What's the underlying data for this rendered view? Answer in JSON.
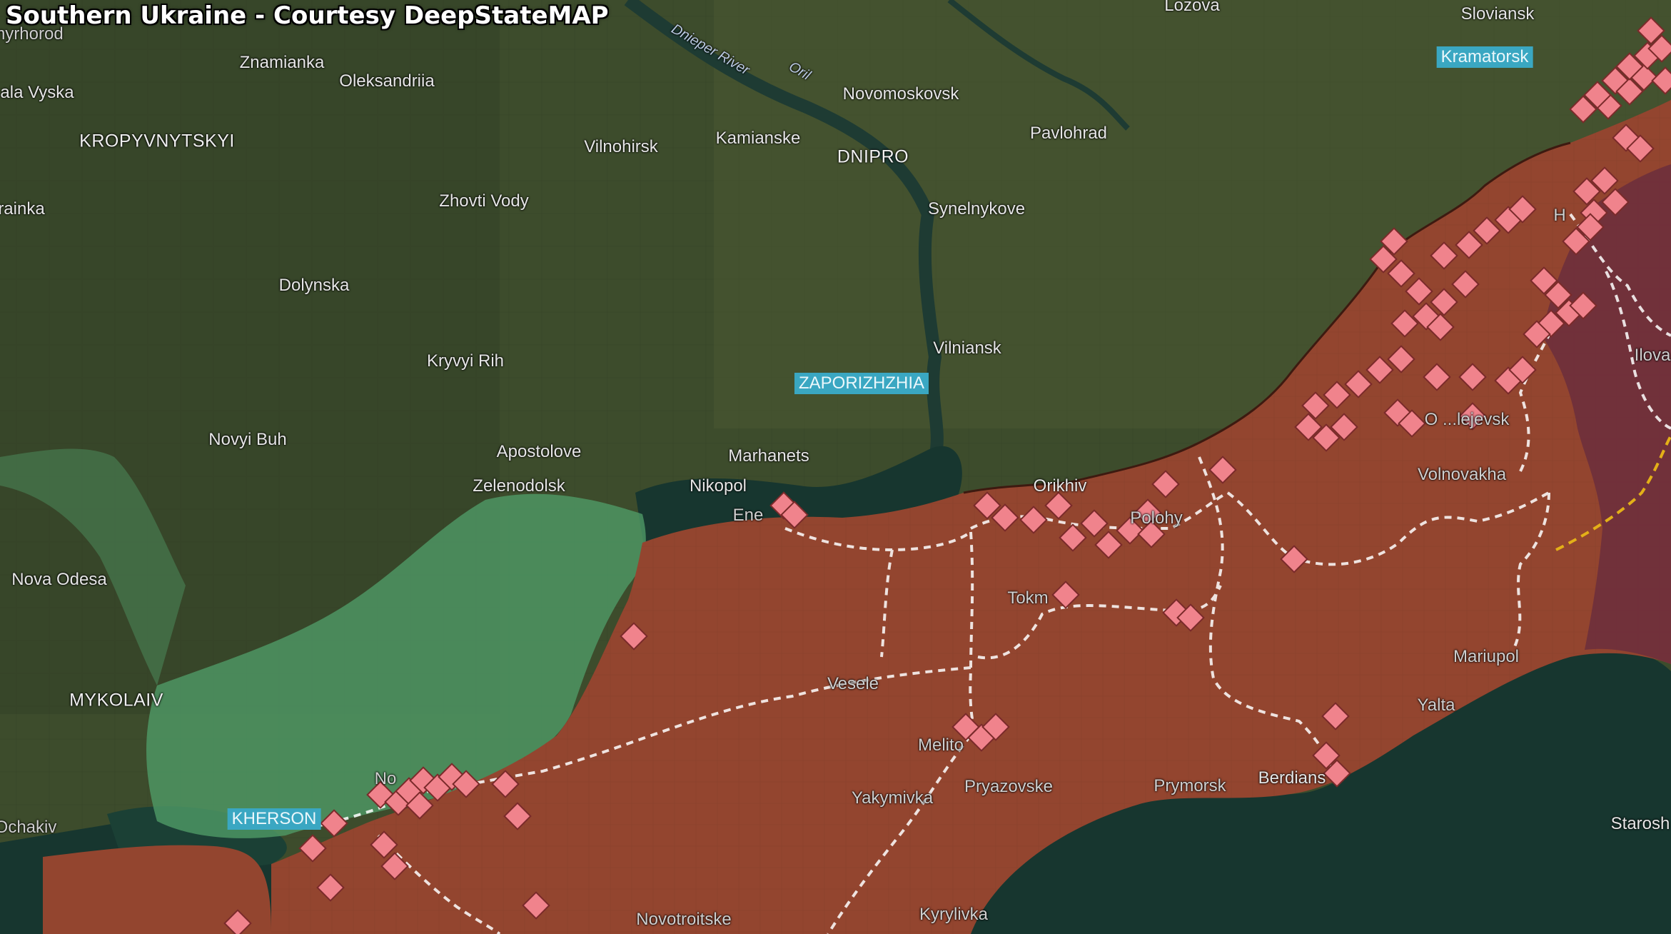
{
  "title": "Southern Ukraine - Courtesy DeepStateMAP",
  "colors": {
    "occupied": "#93452f",
    "liberated": "#4f9a66",
    "occupied_pre2022": "#6e2f3c",
    "water": "#17362f",
    "marker": "#f0838c",
    "highlight_label": "#3aa7c2",
    "road": "#ffffff",
    "border_line": "#e3b018"
  },
  "labels": {
    "myrhorod": "myrhorod",
    "lozova": "Lozova",
    "sloviansk": "Sloviansk",
    "kramatorsk": "Kramatorsk",
    "znamianka": "Znamianka",
    "oleksandriia": "Oleksandriia",
    "mala_vyska": "ala Vyska",
    "kropyvnytskyi": "KROPYVNYTSKYI",
    "dnieper_river": "Dnieper River",
    "orel": "Oril",
    "novomoskovsk": "Novomoskovsk",
    "vilnohirsk": "Vilnohirsk",
    "kamianske": "Kamianske",
    "dnipro": "DNIPRO",
    "pavlohrad": "Pavlohrad",
    "ukrainka": "rainka",
    "zhovti_vody": "Zhovti Vody",
    "synelnykove": "Synelnykove",
    "dolynska": "Dolynska",
    "kryvyi_rih": "Kryvyi Rih",
    "vilniansk": "Vilniansk",
    "zaporizhzhia": "ZAPORIZHZHIA",
    "novyi_buh": "Novyi Buh",
    "apostolove": "Apostolove",
    "marhanets": "Marhanets",
    "zelenodolsk": "Zelenodolsk",
    "nikopol": "Nikopol",
    "orikhiv": "Orikhiv",
    "enerhodar": "Ene",
    "polohy": "Polohy",
    "volnovakha": "Volnovakha",
    "olenivka": "O ...lejevsk",
    "nova_odesa": "Nova Odesa",
    "mykolaiv": "MYKOLAIV",
    "tokmak": "Tokm",
    "vesele": "Vesele",
    "mariupol": "Mariupol",
    "yalta": "Yalta",
    "melitopol": "Melito",
    "yakymivka": "Yakymivka",
    "pryazovske": "Pryazovske",
    "prymorsk": "Prymorsk",
    "berdiansk": "Berdians",
    "kherson": "KHERSON",
    "ochakiv": "Ochakiv",
    "starosh": "Starosh",
    "novotroitske": "Novotroitske",
    "kyrylivka": "Kyrylivka",
    "ilovaisk": "Ilova",
    "horlivka": "H",
    "nova_kakhovka": "No"
  }
}
